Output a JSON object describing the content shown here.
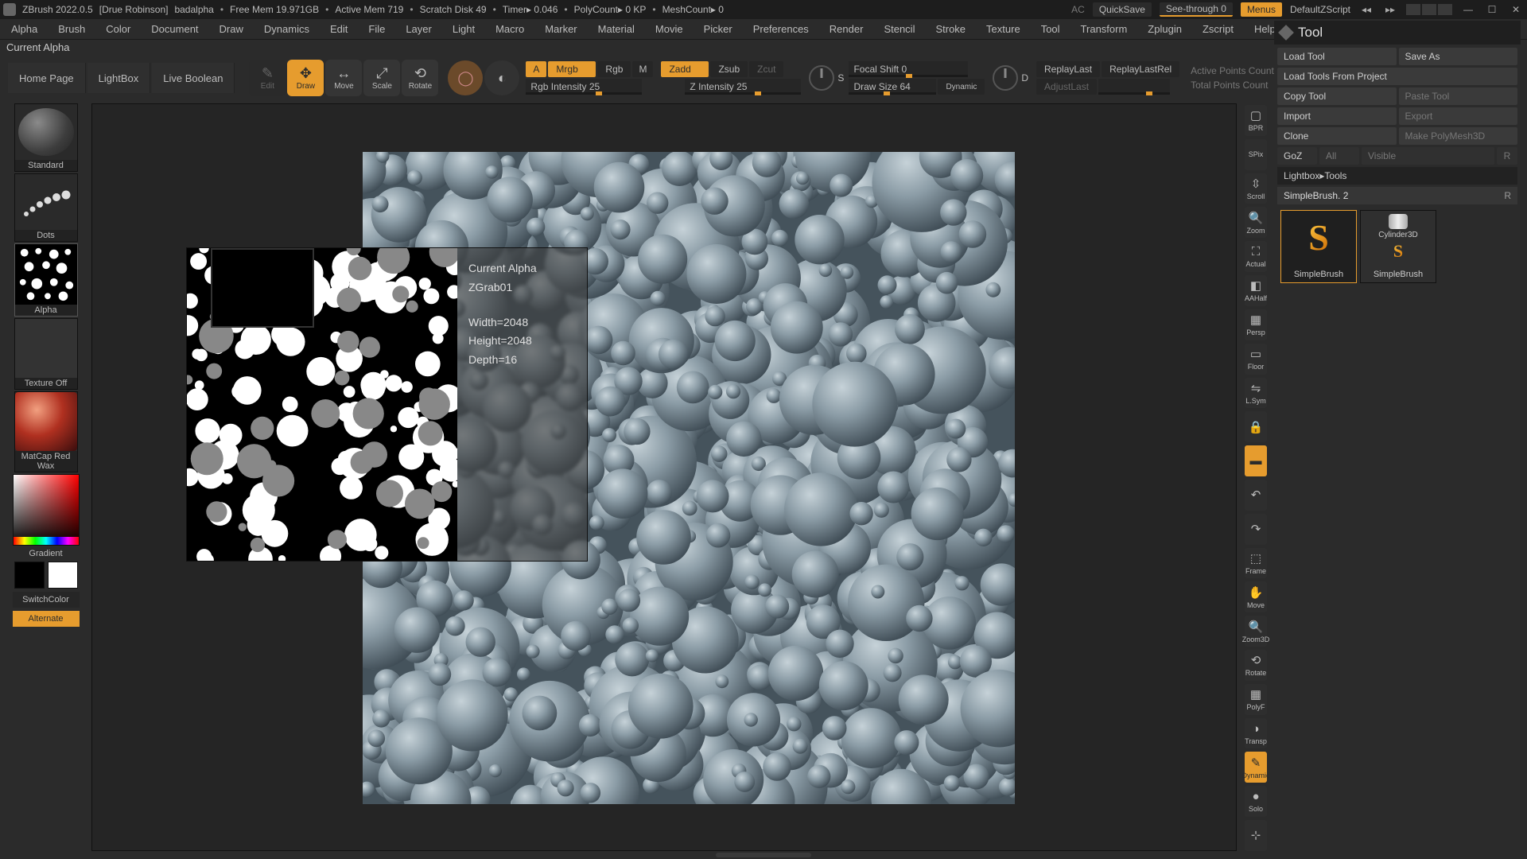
{
  "title": {
    "app": "ZBrush 2022.0.5",
    "user": "[Drue Robinson]",
    "doc": "badalpha",
    "stats": [
      "Free Mem 19.971GB",
      "Active Mem 719",
      "Scratch Disk 49",
      "Timer▸ 0.046",
      "PolyCount▸ 0 KP",
      "MeshCount▸ 0"
    ],
    "ac": "AC",
    "quicksave": "QuickSave",
    "seethrough": "See-through  0",
    "menus": "Menus",
    "zscript": "DefaultZScript"
  },
  "menus": [
    "Alpha",
    "Brush",
    "Color",
    "Document",
    "Draw",
    "Dynamics",
    "Edit",
    "File",
    "Layer",
    "Light",
    "Macro",
    "Marker",
    "Material",
    "Movie",
    "Picker",
    "Preferences",
    "Render",
    "Stencil",
    "Stroke",
    "Texture",
    "Tool",
    "Transform",
    "Zplugin",
    "Zscript",
    "Help"
  ],
  "status": "Current Alpha",
  "shelf": {
    "nav": [
      "Home Page",
      "LightBox",
      "Live Boolean"
    ],
    "modes": {
      "edit": "Edit",
      "draw": "Draw",
      "move": "Move",
      "scale": "Scale",
      "rotate": "Rotate"
    },
    "color": {
      "a": "A",
      "mrgb": "Mrgb",
      "rgb": "Rgb",
      "m": "M",
      "rgbint": "Rgb Intensity",
      "rgbint_v": "25",
      "zadd": "Zadd",
      "zsub": "Zsub",
      "zcut": "Zcut",
      "zint": "Z Intensity",
      "zint_v": "25"
    },
    "draw": {
      "focal": "Focal Shift",
      "focal_v": "0",
      "size": "Draw Size",
      "size_v": "64",
      "dynamic": "Dynamic"
    },
    "dials": {
      "s": "S",
      "d": "D"
    },
    "replay": {
      "last": "ReplayLast",
      "rel": "ReplayLastRel",
      "adjust": "AdjustLast"
    },
    "counts": {
      "active": "Active Points Count",
      "total": "Total Points Count"
    }
  },
  "left": {
    "brush": "Standard",
    "stroke": "Dots",
    "alpha": "Alpha",
    "texture": "Texture Off",
    "material": "MatCap Red Wax",
    "gradient": "Gradient",
    "switch": "SwitchColor",
    "alternate": "Alternate"
  },
  "popup": {
    "title": "Current Alpha",
    "name": "ZGrab01",
    "width": "Width=2048",
    "height": "Height=2048",
    "depth": "Depth=16"
  },
  "rstrip": [
    "BPR",
    "SPix",
    "Scroll",
    "Zoom",
    "Actual",
    "AAHalf",
    "Persp",
    "Floor",
    "L.Sym",
    "",
    "",
    "",
    "",
    "Frame",
    "Move",
    "Zoom3D",
    "Rotate",
    "PolyF",
    "Transp",
    "Dynamic",
    "Solo",
    ""
  ],
  "tool": {
    "title": "Tool",
    "rows": [
      [
        "Load Tool",
        "Save As"
      ],
      [
        "Load Tools From Project",
        ""
      ],
      [
        "Copy Tool",
        "Paste Tool"
      ],
      [
        "Import",
        "Export"
      ],
      [
        "Clone",
        "Make PolyMesh3D"
      ],
      [
        "GoZ",
        "All",
        "Visible",
        "R"
      ]
    ],
    "lightbox": "Lightbox▸Tools",
    "current": "SimpleBrush.  2",
    "current_r": "R",
    "thumbs": [
      {
        "label": "SimpleBrush"
      },
      {
        "label": "Cylinder3D"
      },
      {
        "label": "SimpleBrush"
      }
    ]
  }
}
